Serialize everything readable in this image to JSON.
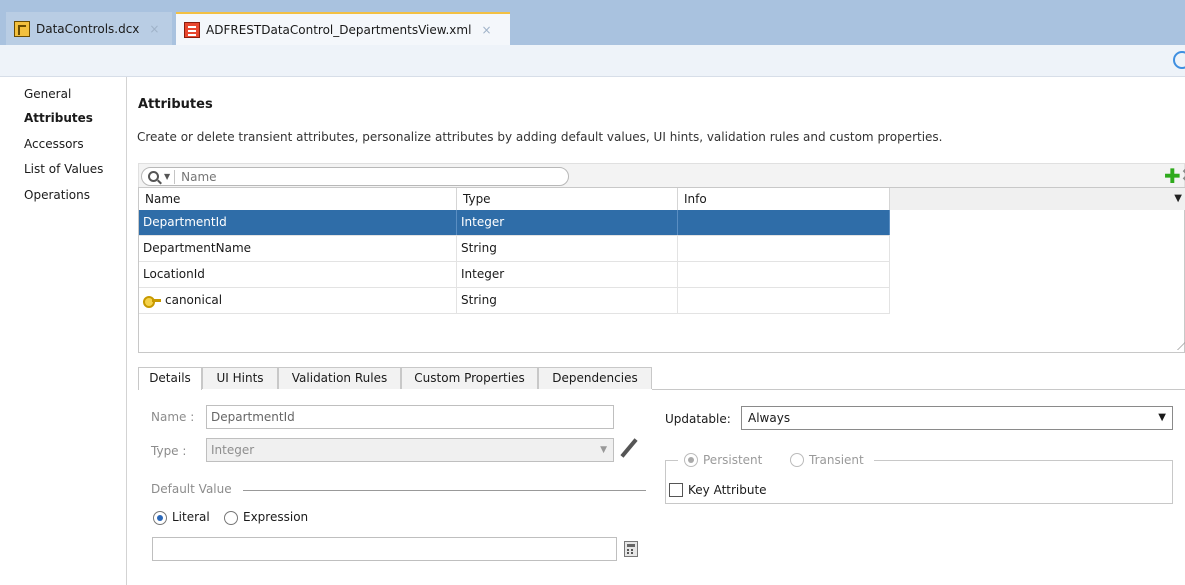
{
  "tabs": [
    {
      "label": "DataControls.dcx",
      "close": "×"
    },
    {
      "label": "ADFRESTDataControl_DepartmentsView.xml",
      "close": "×"
    }
  ],
  "nav": {
    "items": [
      "General",
      "Attributes",
      "Accessors",
      "List of Values",
      "Operations"
    ],
    "active": "Attributes"
  },
  "section": {
    "title": "Attributes",
    "description": "Create or delete transient attributes, personalize attributes by adding default values, UI hints, validation rules and custom properties."
  },
  "search": {
    "placeholder": "Name"
  },
  "toolbar": {
    "add_icon": "plus-icon",
    "delete_icon": "x-icon"
  },
  "grid": {
    "headers": [
      "Name",
      "Type",
      "Info"
    ],
    "rows": [
      {
        "name": "DepartmentId",
        "type": "Integer",
        "info": "",
        "selected": true
      },
      {
        "name": "DepartmentName",
        "type": "String",
        "info": ""
      },
      {
        "name": "LocationId",
        "type": "Integer",
        "info": ""
      },
      {
        "name": "canonical",
        "type": "String",
        "info": "",
        "icon": "key-icon"
      }
    ]
  },
  "detail_tabs": [
    "Details",
    "UI Hints",
    "Validation Rules",
    "Custom Properties",
    "Dependencies"
  ],
  "details": {
    "name_label": "Name :",
    "name_value": "DepartmentId",
    "type_label": "Type :",
    "type_value": "Integer",
    "default_value_label": "Default Value",
    "literal_label": "Literal",
    "expression_label": "Expression",
    "default_value": "",
    "updatable_label": "Updatable:",
    "updatable_value": "Always",
    "persistent_label": "Persistent",
    "transient_label": "Transient",
    "key_attribute_label": "Key Attribute"
  },
  "colors": {
    "tab_accent": "#f2c044",
    "selection": "#2f6da8",
    "add": "#2eaa1c"
  }
}
